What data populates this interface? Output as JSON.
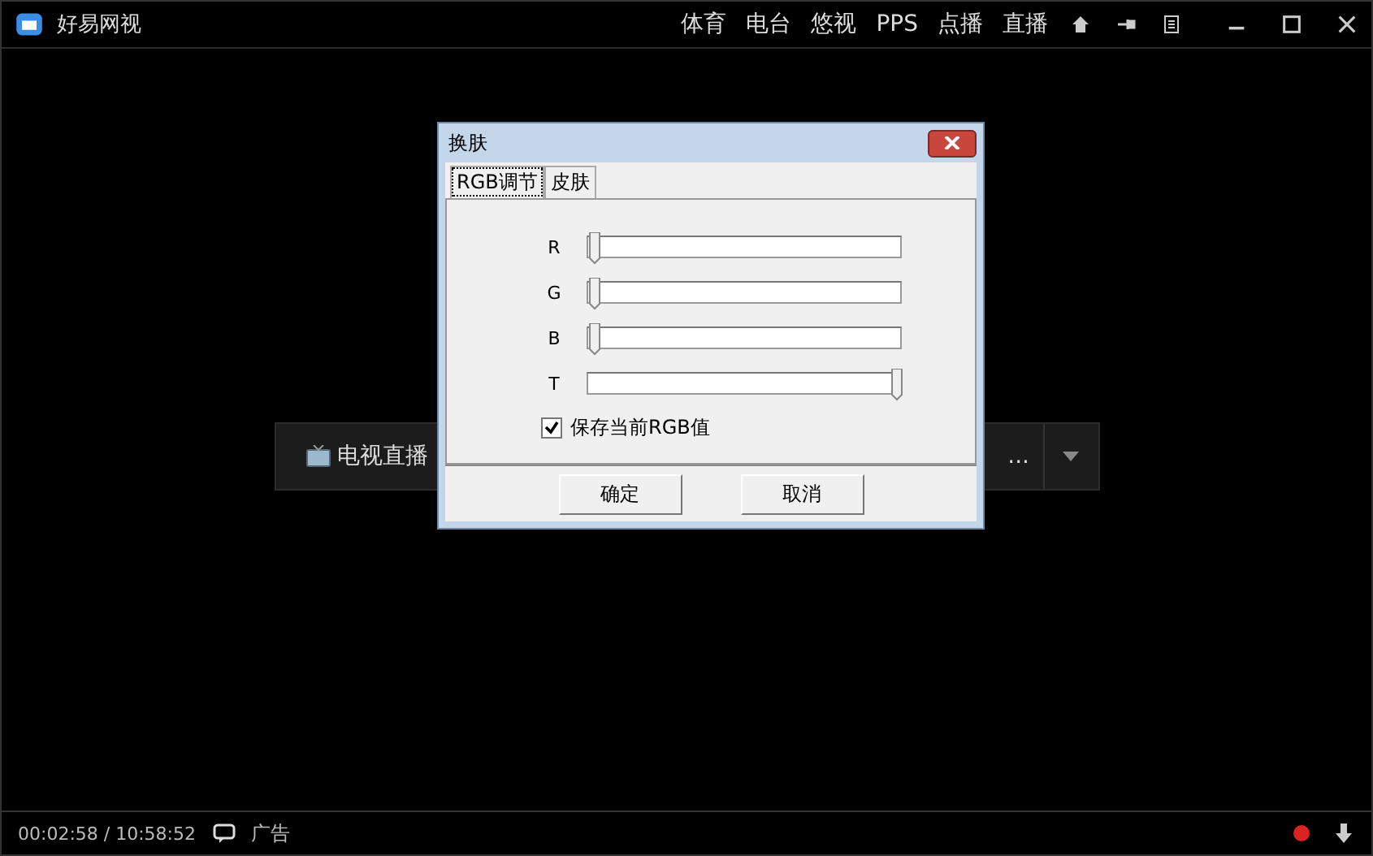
{
  "app": {
    "title": "好易网视"
  },
  "nav": [
    "体育",
    "电台",
    "悠视",
    "PPS",
    "点播",
    "直播"
  ],
  "channel_bar": {
    "label": "电视直播",
    "cut_label": "..."
  },
  "dialog": {
    "title": "换肤",
    "tabs": [
      {
        "label": "RGB调节",
        "selected": true
      },
      {
        "label": "皮肤",
        "selected": false
      }
    ],
    "sliders": [
      {
        "label": "R",
        "level": 0
      },
      {
        "label": "G",
        "level": 0
      },
      {
        "label": "B",
        "level": 0
      },
      {
        "label": "T",
        "level": 1
      }
    ],
    "save_rgb": {
      "label": "保存当前RGB值",
      "checked": true
    },
    "buttons": [
      "确定",
      "取消"
    ]
  },
  "status_bar": {
    "time": "00:02:58 / 10:58:52",
    "ad": "广告"
  }
}
